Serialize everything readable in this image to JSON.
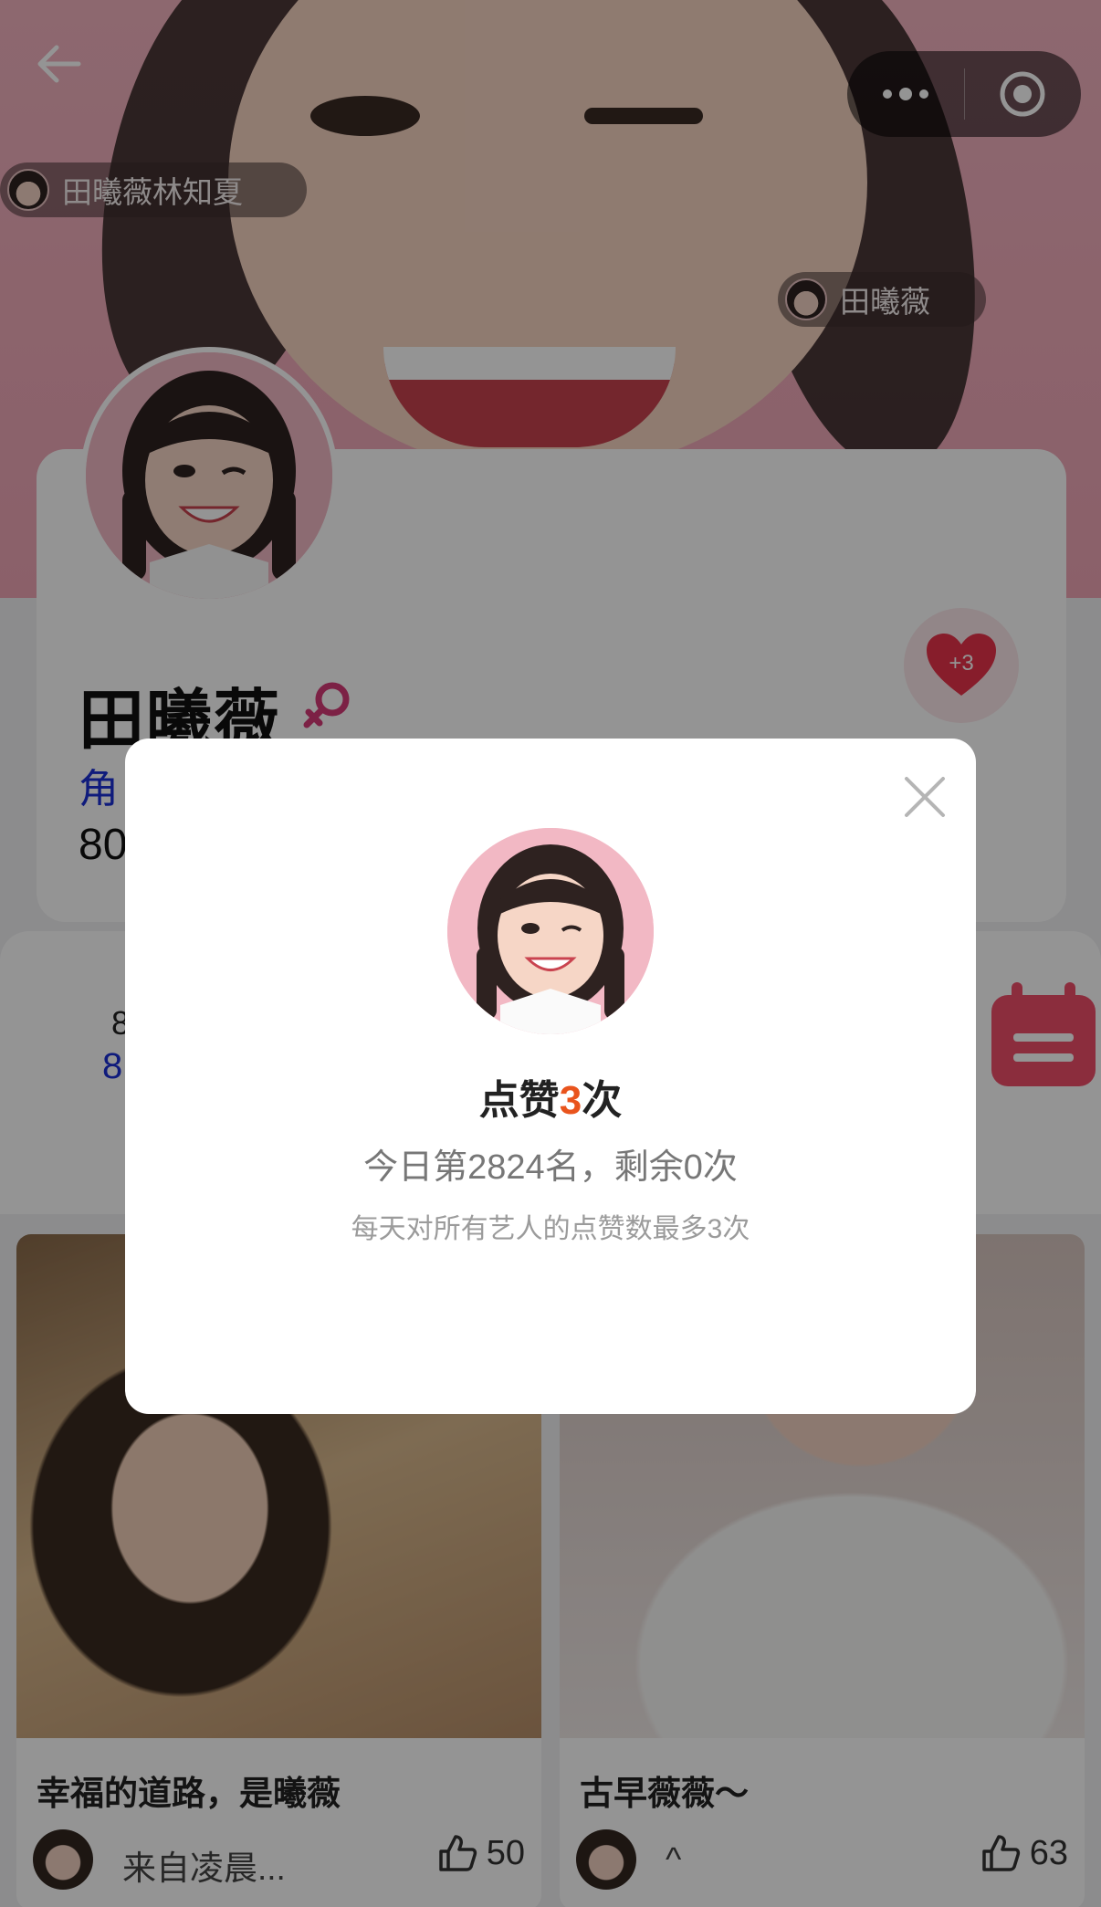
{
  "tags": {
    "top_left": "田曦薇林知夏",
    "mid_right": "田曦薇"
  },
  "profile": {
    "name": "田曦薇",
    "subtitle_partial": "角",
    "number_partial": "80",
    "heart_badge": "+3"
  },
  "stats": {
    "line_a": "8",
    "line_b": "8"
  },
  "posts": [
    {
      "title": "幸福的道路，是曦薇",
      "author": "来自凌晨...",
      "likes": "50"
    },
    {
      "title": "古早薇薇～",
      "author": "^",
      "likes": "63"
    }
  ],
  "modal": {
    "headline_prefix": "点赞",
    "headline_count": "3",
    "headline_suffix": "次",
    "rank_text": "今日第2824名，剩余0次",
    "note_text": "每天对所有艺人的点赞数最多3次"
  },
  "icons": {
    "back": "arrow-left-icon",
    "more": "more-dots-icon",
    "capsule_target": "target-icon",
    "gender": "female-icon",
    "like": "thumbs-up-icon",
    "close": "close-icon",
    "calendar": "calendar-icon",
    "heart": "heart-icon"
  },
  "colors": {
    "accent_orange": "#e9541d",
    "link_blue": "#1b2fd6",
    "heart_red": "#e8324a",
    "female_pink": "#d63a77"
  }
}
